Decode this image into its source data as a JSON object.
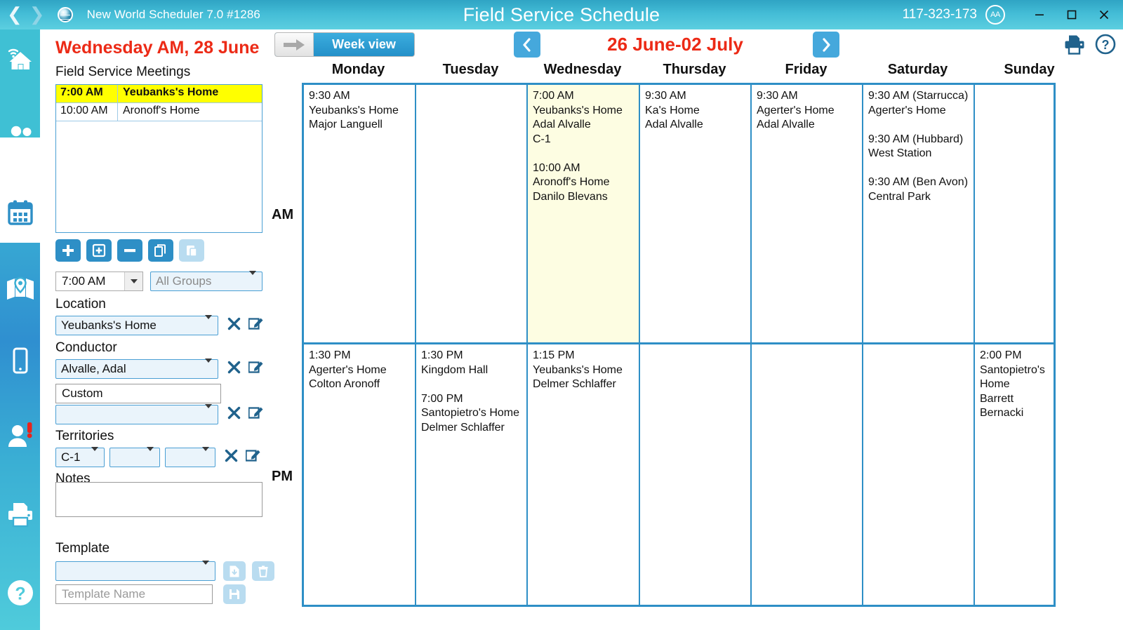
{
  "titlebar": {
    "back_icon": "chevron-left-icon",
    "forward_icon": "chevron-right-icon",
    "app_name": "New World Scheduler 7.0 #1286",
    "window_title": "Field Service Schedule",
    "serial": "117-323-173",
    "font_badge": "AA",
    "minimize": "minimize-icon",
    "maximize": "maximize-icon",
    "close": "close-icon",
    "gradient_top": "#2fa4c4",
    "gradient_bottom": "#5ccfe0"
  },
  "rail": {
    "items": [
      {
        "name": "home-icon",
        "label": "Home"
      },
      {
        "name": "people-icon",
        "label": "Publishers"
      },
      {
        "name": "calendar-icon",
        "label": "Schedules"
      },
      {
        "name": "map-icon",
        "label": "Territories"
      },
      {
        "name": "mobile-icon",
        "label": "Mobile"
      },
      {
        "name": "person-alert-icon",
        "label": "Alerts"
      },
      {
        "name": "printer-icon",
        "label": "Reports"
      },
      {
        "name": "help-icon",
        "label": "Help"
      }
    ]
  },
  "panel": {
    "date_heading": "Wednesday AM, 28 June",
    "section_title": "Field Service Meetings",
    "meetings": [
      {
        "time": "7:00 AM",
        "location": "Yeubanks's Home",
        "selected": true
      },
      {
        "time": "10:00 AM",
        "location": "Aronoff's Home",
        "selected": false
      }
    ],
    "buttons": [
      {
        "name": "add-meeting-button",
        "icon": "plus-icon"
      },
      {
        "name": "add-boxed-button",
        "icon": "plus-box-icon"
      },
      {
        "name": "remove-meeting-button",
        "icon": "minus-icon"
      },
      {
        "name": "copy-button",
        "icon": "copy-icon"
      },
      {
        "name": "paste-button",
        "icon": "paste-icon"
      }
    ],
    "time_value": "7:00 AM",
    "groups_placeholder": "All Groups",
    "location_label": "Location",
    "location_value": "Yeubanks's Home",
    "conductor_label": "Conductor",
    "conductor_value": "Alvalle, Adal",
    "custom_value": "Custom",
    "custom_dropdown_value": "",
    "territories_label": "Territories",
    "territory_1": "C-1",
    "territory_2": "",
    "territory_3": "",
    "notes_label": "Notes",
    "notes_value": "",
    "template_label": "Template",
    "template_value": "",
    "template_name_placeholder": "Template Name",
    "clear_icon": "x-icon",
    "edit_icon": "edit-pencil-icon",
    "template_load_icon": "file-download-icon",
    "template_delete_icon": "trash-icon",
    "template_save_icon": "save-disk-icon"
  },
  "calendar": {
    "view_button_label": "Week view",
    "view_button_icon": "arrow-right-icon",
    "prev_icon": "chevron-left-icon",
    "next_icon": "chevron-right-icon",
    "date_range": "26 June-02 July",
    "print_icon": "printer-icon",
    "help_icon": "question-circle-icon",
    "day_headers": [
      "Monday",
      "Tuesday",
      "Wednesday",
      "Thursday",
      "Friday",
      "Saturday",
      "Sunday"
    ],
    "row_labels": [
      "AM",
      "PM"
    ],
    "am": [
      "9:30 AM\nYeubanks's Home\nMajor Languell",
      "",
      "7:00 AM\nYeubanks's Home\nAdal Alvalle\nC-1\n\n10:00 AM\nAronoff's Home\nDanilo Blevans",
      "9:30 AM\nKa's Home\nAdal Alvalle",
      "9:30 AM\nAgerter's Home\nAdal Alvalle",
      "9:30 AM (Starrucca)\nAgerter's Home\n\n9:30 AM (Hubbard)\nWest Station\n\n9:30 AM (Ben Avon)\nCentral Park",
      ""
    ],
    "pm": [
      "1:30 PM\nAgerter's Home\nColton Aronoff",
      "1:30 PM\nKingdom Hall\n\n7:00 PM\nSantopietro's Home\nDelmer Schlaffer",
      "1:15 PM\nYeubanks's Home\nDelmer Schlaffer",
      "",
      "",
      "",
      "2:00 PM\nSantopietro's Home\nBarrett Bernacki"
    ],
    "highlight_day_index": 2,
    "highlight_color": "#fdfde2",
    "grid_border_color": "#2e8fc6",
    "accent_red": "#ec2a16"
  }
}
